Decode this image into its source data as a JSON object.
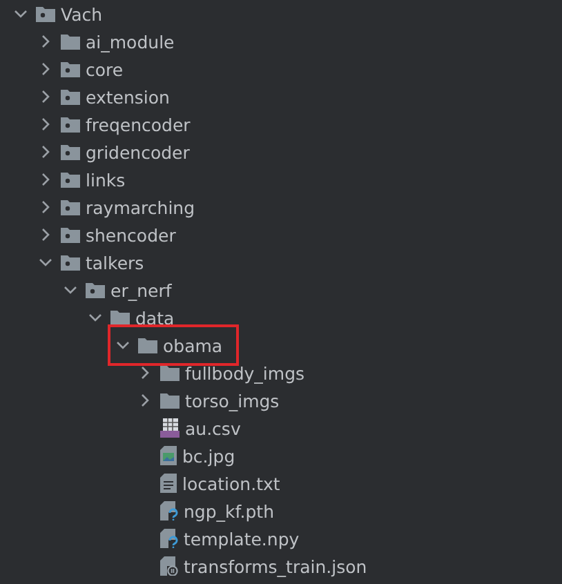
{
  "tree": [
    {
      "name": "Vach",
      "kind": "module",
      "expanded": true,
      "highlighted": false,
      "children": [
        {
          "name": "ai_module",
          "kind": "folder",
          "expanded": false,
          "highlighted": false
        },
        {
          "name": "core",
          "kind": "module",
          "expanded": false,
          "highlighted": false
        },
        {
          "name": "extension",
          "kind": "module",
          "expanded": false,
          "highlighted": false
        },
        {
          "name": "freqencoder",
          "kind": "module",
          "expanded": false,
          "highlighted": false
        },
        {
          "name": "gridencoder",
          "kind": "module",
          "expanded": false,
          "highlighted": false
        },
        {
          "name": "links",
          "kind": "module",
          "expanded": false,
          "highlighted": false
        },
        {
          "name": "raymarching",
          "kind": "module",
          "expanded": false,
          "highlighted": false
        },
        {
          "name": "shencoder",
          "kind": "module",
          "expanded": false,
          "highlighted": false
        },
        {
          "name": "talkers",
          "kind": "module",
          "expanded": true,
          "highlighted": false,
          "children": [
            {
              "name": "er_nerf",
              "kind": "module",
              "expanded": true,
              "highlighted": false,
              "children": [
                {
                  "name": "data",
                  "kind": "folder",
                  "expanded": true,
                  "highlighted": false,
                  "children": [
                    {
                      "name": "obama",
                      "kind": "folder",
                      "expanded": true,
                      "highlighted": true,
                      "children": [
                        {
                          "name": "fullbody_imgs",
                          "kind": "folder",
                          "expanded": false,
                          "highlighted": false
                        },
                        {
                          "name": "torso_imgs",
                          "kind": "folder",
                          "expanded": false,
                          "highlighted": false
                        },
                        {
                          "name": "au.csv",
                          "kind": "csv",
                          "highlighted": false
                        },
                        {
                          "name": "bc.jpg",
                          "kind": "image",
                          "highlighted": false
                        },
                        {
                          "name": "location.txt",
                          "kind": "text",
                          "highlighted": false
                        },
                        {
                          "name": "ngp_kf.pth",
                          "kind": "unknown",
                          "highlighted": false
                        },
                        {
                          "name": "template.npy",
                          "kind": "unknown",
                          "highlighted": false
                        },
                        {
                          "name": "transforms_train.json",
                          "kind": "json",
                          "highlighted": false
                        }
                      ]
                    }
                  ]
                }
              ]
            }
          ]
        }
      ]
    }
  ]
}
